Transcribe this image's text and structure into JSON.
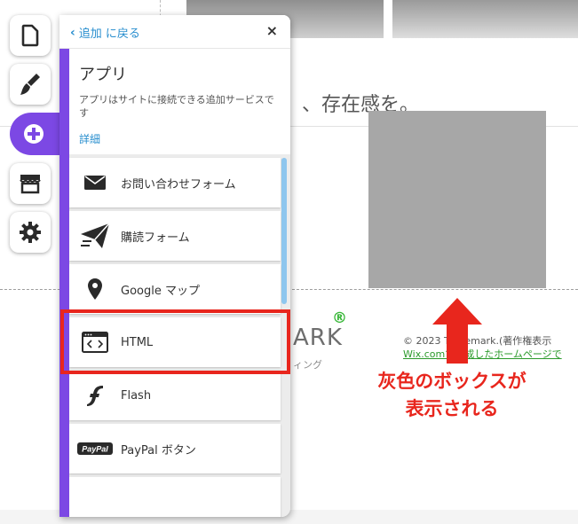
{
  "canvas": {
    "hero_text": "、存在感を。",
    "logo_text": "ARK",
    "logo_reg": "®",
    "logo_sub": "ィング",
    "copyright": "© 2023 Trademark.(著作権表示",
    "wix_link": "Wix.comで作成したホームページで"
  },
  "annotation": {
    "line1": "灰色のボックスが",
    "line2": "表示される",
    "color": "#e8261d"
  },
  "toolbar": {
    "items": [
      {
        "name": "pages",
        "icon": "page-icon"
      },
      {
        "name": "design",
        "icon": "paintbrush-icon"
      },
      {
        "name": "add",
        "icon": "plus-circle-icon",
        "active": true
      },
      {
        "name": "store",
        "icon": "store-icon"
      },
      {
        "name": "settings",
        "icon": "gear-icon"
      }
    ],
    "accent": "#7c48e4"
  },
  "panel": {
    "back_label": "追加 に戻る",
    "close_label": "×",
    "title": "アプリ",
    "description": "アプリはサイトに接続できる追加サービスです",
    "details_label": "詳細",
    "items": [
      {
        "label": "お問い合わせフォーム",
        "icon": "envelope-icon"
      },
      {
        "label": "購読フォーム",
        "icon": "paper-plane-icon"
      },
      {
        "label": "Google マップ",
        "icon": "map-pin-icon"
      },
      {
        "label": "HTML",
        "icon": "code-window-icon",
        "highlighted": true
      },
      {
        "label": "Flash",
        "icon": "flash-icon"
      },
      {
        "label": "PayPal ボタン",
        "icon": "paypal-icon"
      }
    ]
  }
}
